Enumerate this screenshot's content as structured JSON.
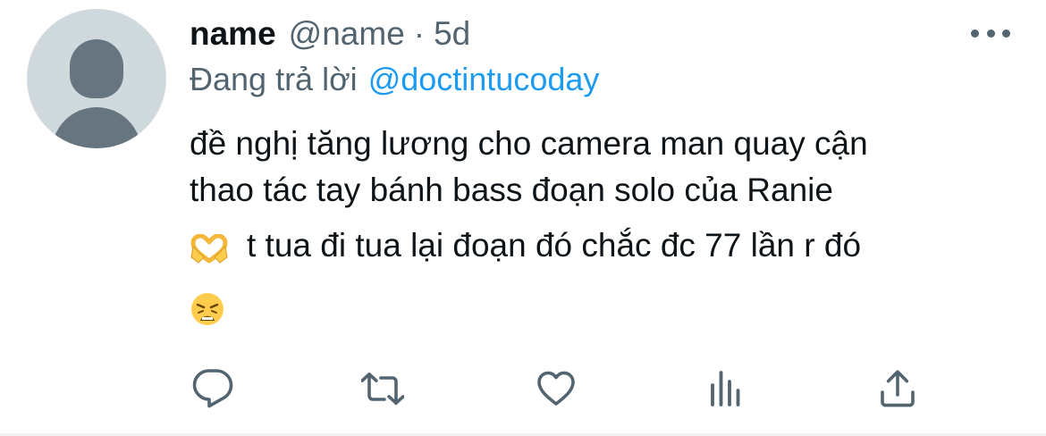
{
  "tweet": {
    "display_name": "name",
    "handle": "@name",
    "separator": "·",
    "time": "5d",
    "reply_prefix": "Đang trả lời",
    "reply_mention": "@doctintucoday",
    "text_line_1": "đề nghị tăng lương cho camera man quay cận",
    "text_line_2": "thao tác tay bánh bass đoạn solo của Ranie",
    "text_line_3": "t tua đi tua lại đoạn đó chắc đc 77 lần r đó",
    "emojis": [
      "heart-hands-emoji",
      "weary-face-emoji"
    ]
  },
  "icons": {
    "more": "more-horizontal-icon",
    "reply": "reply-bubble-icon",
    "retweet": "retweet-icon",
    "like": "heart-icon",
    "views": "bar-chart-icon",
    "share": "share-upload-icon"
  },
  "colors": {
    "text": "#0f1419",
    "secondary": "#536471",
    "link": "#1d9bf0",
    "avatar_bg": "#cfd9de",
    "avatar_fg": "#66757f"
  }
}
